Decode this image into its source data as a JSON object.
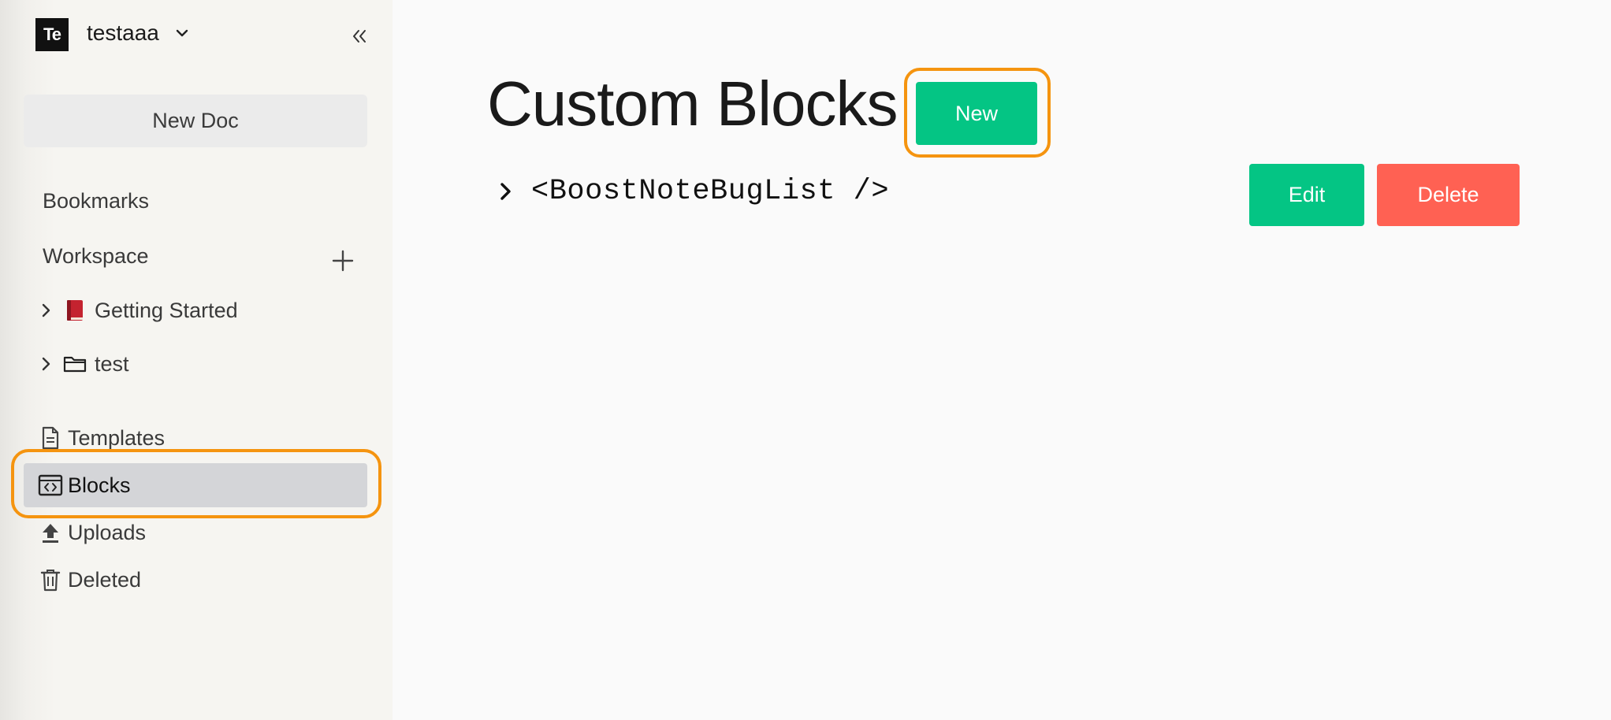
{
  "team": {
    "logo_text": "Te",
    "name": "testaaa"
  },
  "sidebar": {
    "new_doc_label": "New Doc",
    "bookmarks_label": "Bookmarks",
    "workspace_label": "Workspace",
    "tree": [
      {
        "emoji": "📕",
        "label": "Getting Started",
        "icon": "book-icon"
      },
      {
        "emoji": "",
        "label": "test",
        "icon": "folder-icon"
      }
    ],
    "items": [
      {
        "label": "Templates",
        "icon": "document-icon"
      },
      {
        "label": "Blocks",
        "icon": "code-block-icon",
        "active": true
      },
      {
        "label": "Uploads",
        "icon": "upload-icon"
      },
      {
        "label": "Deleted",
        "icon": "trash-icon"
      }
    ]
  },
  "main": {
    "title": "Custom Blocks",
    "new_label": "New",
    "blocks": [
      {
        "name": "<BoostNoteBugList />",
        "edit_label": "Edit",
        "delete_label": "Delete"
      }
    ]
  },
  "colors": {
    "accent": "#04c584",
    "danger": "#ff6153",
    "highlight": "#f5940f",
    "active_bg": "#d4d5d8"
  }
}
